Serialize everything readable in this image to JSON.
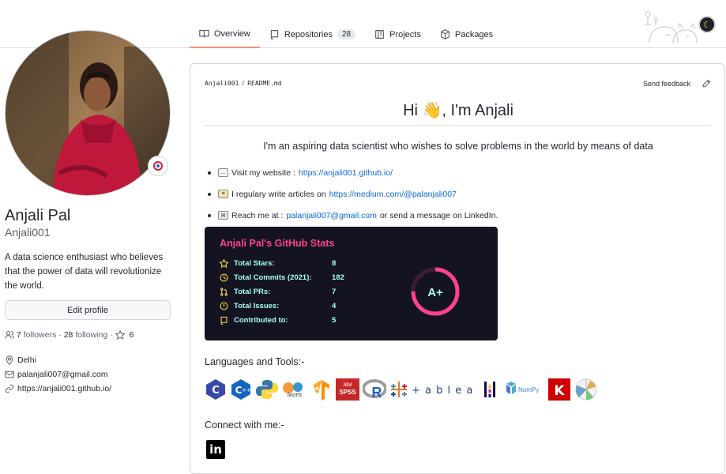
{
  "nav": {
    "tabs": [
      {
        "label": "Overview",
        "icon": "book-icon",
        "active": true
      },
      {
        "label": "Repositories",
        "icon": "repo-icon",
        "count": "28"
      },
      {
        "label": "Projects",
        "icon": "project-icon"
      },
      {
        "label": "Packages",
        "icon": "package-icon"
      }
    ]
  },
  "profile": {
    "name": "Anjali Pal",
    "username": "Anjali001",
    "bio": "A data science enthusiast who believes that the power of data will revolutionize the world.",
    "edit_label": "Edit profile",
    "followers_count": "7",
    "followers_label": "followers",
    "following_count": "28",
    "following_label": "following",
    "stars_count": "6",
    "location": "Delhi",
    "email": "palanjali007@gmail.com",
    "website": "https://anjali001.github.io/"
  },
  "readme": {
    "crumb_user": "Anjali001",
    "crumb_file": "README.md",
    "feedback_label": "Send feedback",
    "title": "Hi 👋, I'm Anjali",
    "tagline": "I'm an aspiring data scientist who wishes to solve problems in the world by means of data",
    "bullets": [
      {
        "text": "Visit my website :",
        "link": "https://anjali001.github.io/",
        "after": ""
      },
      {
        "text": "I regulary write articles on",
        "link": "https://medium.com/@palanjali007",
        "after": ""
      },
      {
        "text": "Reach me at :",
        "link": "palanjali007@gmail.com",
        "after": "or send a message on LinkedIn."
      }
    ],
    "stats": {
      "title": "Anjali Pal's GitHub Stats",
      "rows": [
        {
          "label": "Total Stars:",
          "value": "8"
        },
        {
          "label": "Total Commits (2021):",
          "value": "182"
        },
        {
          "label": "Total PRs:",
          "value": "7"
        },
        {
          "label": "Total Issues:",
          "value": "4"
        },
        {
          "label": "Contributed to:",
          "value": "5"
        }
      ],
      "grade": "A+",
      "accent": "#fe428e",
      "text_color": "#a9fef7",
      "bg": "#141321"
    },
    "langs_heading": "Languages and Tools:-",
    "langs": [
      "C",
      "C++",
      "Python",
      "scikit-learn",
      "TensorFlow",
      "SPSS",
      "R",
      "Tableau",
      "Pandas",
      "NumPy",
      "Keras",
      "Seaborn"
    ],
    "spss_line1": "IBM",
    "spss_line2": "SPSS",
    "tableau_text": "+ a b l e a u",
    "numpy_text": "NumPy",
    "keras_text": "K",
    "sklearn_text": "learn",
    "connect_heading": "Connect with me:-",
    "linkedin_text": "in"
  }
}
